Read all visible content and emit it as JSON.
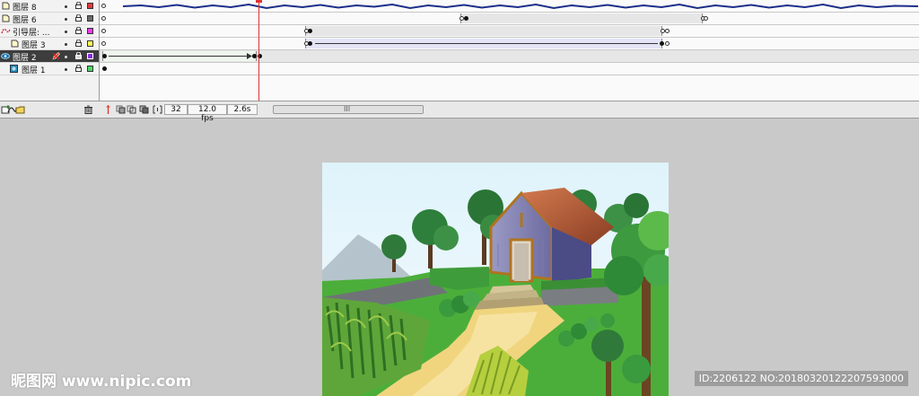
{
  "layers": [
    {
      "name": "图层 8",
      "color": "#e23b3b",
      "type": "normal",
      "selected": false
    },
    {
      "name": "图层 6",
      "color": "#6a6a6a",
      "type": "normal",
      "selected": false
    },
    {
      "name": "引导层: ...",
      "color": "#ef3bef",
      "type": "guide",
      "selected": false
    },
    {
      "name": "图层 3",
      "color": "#ffff55",
      "type": "guided",
      "selected": false
    },
    {
      "name": "图层 2",
      "color": "#8a2be2",
      "type": "normal",
      "selected": true
    },
    {
      "name": "图层 1",
      "color": "#4cd964",
      "type": "normal",
      "selected": false
    }
  ],
  "timeline": {
    "current_frame": "32",
    "fps": "12.0 fps",
    "elapsed": "2.6s",
    "scroll_grip": "III"
  },
  "icons": {
    "add_layer": "add-layer-icon",
    "add_guide": "add-motion-guide-icon",
    "add_folder": "add-folder-icon",
    "delete_layer": "trash-icon",
    "center_frame": "center-frame-icon",
    "onion_skin": "onion-skin-icon",
    "onion_outline": "onion-skin-outline-icon",
    "edit_multiple": "edit-multiple-frames-icon",
    "onion_markers": "onion-markers-icon"
  },
  "watermark": {
    "site": "昵图网 www.nipic.com",
    "id": "ID:2206122 NO:20180320122207593000"
  }
}
